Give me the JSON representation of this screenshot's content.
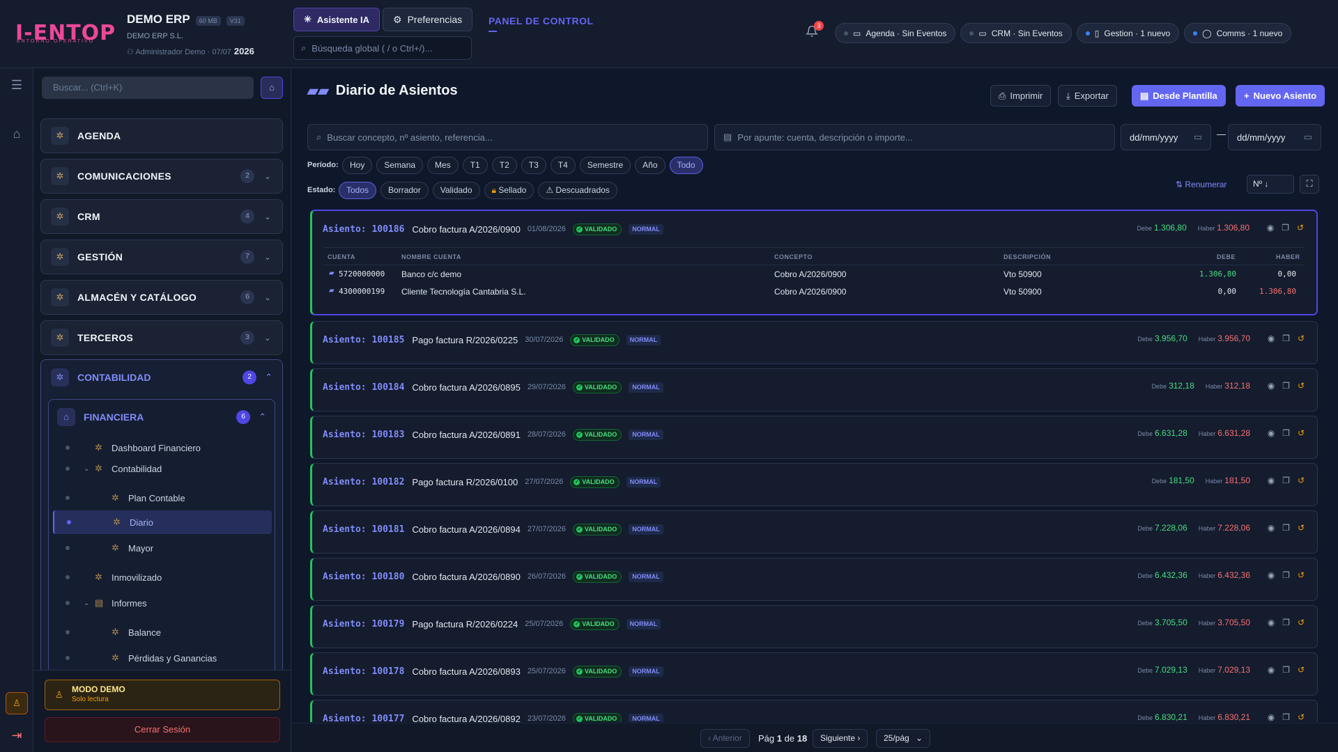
{
  "header": {
    "logo": "I-ENTOP",
    "logo_sub": "ENTORNO OPERATIVO",
    "company": "DEMO ERP",
    "mem_badge": "60 MB",
    "ver_badge": "V31",
    "company_sub": "DEMO ERP S.L.",
    "user": "Administrador Demo",
    "date": "07/07",
    "year": "2026",
    "ai_label": "Asistente IA",
    "pref_label": "Preferencias",
    "search_placeholder": "Búsqueda global ( / o Ctrl+/)...",
    "panel": "PANEL DE CONTROL",
    "notif_count": "3",
    "pills": [
      "Agenda · Sin Eventos",
      "CRM · Sin Eventos",
      "Gestion · 1 nuevo",
      "Comms · 1 nuevo"
    ]
  },
  "sidebar": {
    "search": "Buscar... (Ctrl+K)",
    "modules": [
      {
        "label": "AGENDA",
        "count": ""
      },
      {
        "label": "COMUNICACIONES",
        "count": "2"
      },
      {
        "label": "CRM",
        "count": "4"
      },
      {
        "label": "GESTIÓN",
        "count": "7"
      },
      {
        "label": "ALMACÉN Y CATÁLOGO",
        "count": "6"
      },
      {
        "label": "TERCEROS",
        "count": "3"
      }
    ],
    "contab": {
      "label": "CONTABILIDAD",
      "count": "2"
    },
    "fin": {
      "label": "FINANCIERA",
      "count": "6"
    },
    "tree": [
      "Dashboard Financiero",
      "Contabilidad",
      "Plan Contable",
      "Diario",
      "Mayor",
      "Inmovilizado",
      "Informes",
      "Balance",
      "Pérdidas y Ganancias"
    ],
    "demo_title": "MODO DEMO",
    "demo_sub": "Solo lectura",
    "logout": "Cerrar Sesión"
  },
  "main": {
    "title": "Diario de Asientos",
    "btn_print": "Imprimir",
    "btn_export": "Exportar",
    "btn_template": "Desde Plantilla",
    "btn_new": "Nuevo Asiento",
    "search_concept": "Buscar concepto, nº asiento, referencia...",
    "search_apunte": "Por apunte: cuenta, descripción o importe...",
    "date_from": "dd/mm/yyyy",
    "date_to": "dd/mm/yyyy",
    "date_sep": "—",
    "periodo_label": "Período:",
    "periodos": [
      "Hoy",
      "Semana",
      "Mes",
      "T1",
      "T2",
      "T3",
      "T4",
      "Semestre",
      "Año",
      "Todo"
    ],
    "estado_label": "Estado:",
    "estados": [
      "Todos",
      "Borrador",
      "Validado",
      "Sellado",
      "Descuadrados"
    ],
    "renum": "Renumerar",
    "sort": "Nº ↓",
    "lbl_asiento": "Asiento:",
    "lbl_debe": "Debe",
    "lbl_haber": "Haber",
    "status_badge": "VALIDADO",
    "type_badge": "NORMAL",
    "cols": [
      "CUENTA",
      "NOMBRE CUENTA",
      "CONCEPTO",
      "DESCRIPCIÓN",
      "DEBE",
      "HABER"
    ],
    "lines": [
      {
        "cuenta": "5720000000",
        "nombre": "Banco c/c demo",
        "concepto": "Cobro A/2026/0900",
        "desc": "Vto 50900",
        "debe": "1.306,80",
        "haber": "0,00"
      },
      {
        "cuenta": "4300000199",
        "nombre": "Cliente Tecnología Cantabria S.L.",
        "concepto": "Cobro A/2026/0900",
        "desc": "Vto 50900",
        "debe": "0,00",
        "haber": "1.306,80"
      }
    ],
    "entries": [
      {
        "num": "100186",
        "concept": "Cobro factura A/2026/0900",
        "date": "01/08/2026",
        "debe": "1.306,80",
        "haber": "1.306,80"
      },
      {
        "num": "100185",
        "concept": "Pago factura R/2026/0225",
        "date": "30/07/2026",
        "debe": "3.956,70",
        "haber": "3.956,70"
      },
      {
        "num": "100184",
        "concept": "Cobro factura A/2026/0895",
        "date": "29/07/2026",
        "debe": "312,18",
        "haber": "312,18"
      },
      {
        "num": "100183",
        "concept": "Cobro factura A/2026/0891",
        "date": "28/07/2026",
        "debe": "6.631,28",
        "haber": "6.631,28"
      },
      {
        "num": "100182",
        "concept": "Pago factura R/2026/0100",
        "date": "27/07/2026",
        "debe": "181,50",
        "haber": "181,50"
      },
      {
        "num": "100181",
        "concept": "Cobro factura A/2026/0894",
        "date": "27/07/2026",
        "debe": "7.228,06",
        "haber": "7.228,06"
      },
      {
        "num": "100180",
        "concept": "Cobro factura A/2026/0890",
        "date": "26/07/2026",
        "debe": "6.432,36",
        "haber": "6.432,36"
      },
      {
        "num": "100179",
        "concept": "Pago factura R/2026/0224",
        "date": "25/07/2026",
        "debe": "3.705,50",
        "haber": "3.705,50"
      },
      {
        "num": "100178",
        "concept": "Cobro factura A/2026/0893",
        "date": "25/07/2026",
        "debe": "7.029,13",
        "haber": "7.029,13"
      },
      {
        "num": "100177",
        "concept": "Cobro factura A/2026/0892",
        "date": "23/07/2026",
        "debe": "6.830,21",
        "haber": "6.830,21"
      }
    ],
    "pager": {
      "prev": "Anterior",
      "pag": "Pág",
      "page": "1",
      "de": "de",
      "total": "18",
      "next": "Siguiente",
      "per_page": "25/pág"
    }
  },
  "colors": {
    "accent": "#6366f1",
    "success": "#22c55e",
    "danger": "#f87171",
    "brand": "#ec4899"
  }
}
